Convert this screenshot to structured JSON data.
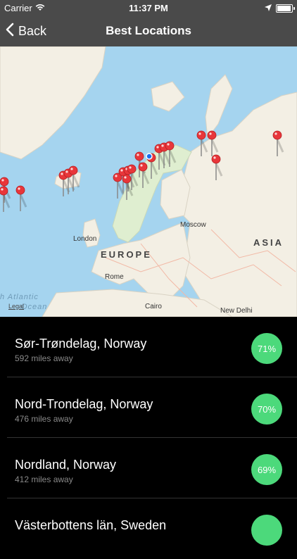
{
  "status_bar": {
    "carrier": "Carrier",
    "time": "11:37 PM"
  },
  "nav": {
    "back_label": "Back",
    "title": "Best Locations"
  },
  "map": {
    "labels": {
      "moscow": "Moscow",
      "london": "London",
      "europe": "EUROPE",
      "asia": "ASIA",
      "rome": "Rome",
      "cairo": "Cairo",
      "new_delhi": "New Delhi",
      "atlantic": "h Atlantic",
      "ocean": "Ocean",
      "legal": "Legal"
    },
    "pin_color": "#e8363a",
    "user_location_color": "#1a6ef0"
  },
  "locations": [
    {
      "name": "Sør-Trøndelag, Norway",
      "distance": "592 miles away",
      "score": "71%"
    },
    {
      "name": "Nord-Trondelag, Norway",
      "distance": "476 miles away",
      "score": "70%"
    },
    {
      "name": "Nordland, Norway",
      "distance": "412 miles away",
      "score": "69%"
    },
    {
      "name": "Västerbottens län, Sweden",
      "distance": "",
      "score": ""
    }
  ],
  "colors": {
    "bar": "#4a4a4a",
    "badge": "#4cd97b",
    "list_bg": "#000000"
  }
}
